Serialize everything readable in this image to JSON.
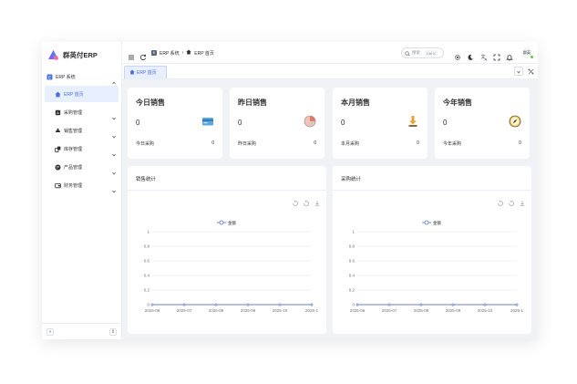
{
  "app": {
    "name": "群英付ERP"
  },
  "colors": {
    "accent": "#4a6fe0",
    "line": "#5470c6",
    "active_bg": "#e8efff"
  },
  "sidebar": {
    "group": {
      "label": "ERP 系统",
      "icon": "erp-icon"
    },
    "items": [
      {
        "label": "ERP 首页",
        "icon": "home-icon",
        "active": true
      },
      {
        "label": "采购管理",
        "icon": "purchase-icon"
      },
      {
        "label": "销售管理",
        "icon": "sales-icon"
      },
      {
        "label": "库存管理",
        "icon": "stock-icon"
      },
      {
        "label": "产品管理",
        "icon": "product-icon"
      },
      {
        "label": "财务管理",
        "icon": "finance-icon"
      }
    ],
    "collapse_label": "«",
    "lock_label": "⇕"
  },
  "header": {
    "breadcrumb": [
      "ERP 系统",
      "ERP 首页"
    ],
    "search_placeholder": "搜索",
    "shortcut": "Ctrl K",
    "avatar_label": "群英"
  },
  "tabs": [
    {
      "label": "ERP 首页"
    }
  ],
  "cards": [
    {
      "title": "今日销售",
      "value": "0",
      "foot_label": "今日采购",
      "foot_value": "0",
      "icon": "credit-card-icon"
    },
    {
      "title": "昨日销售",
      "value": "0",
      "foot_label": "昨日采购",
      "foot_value": "0",
      "icon": "pie-chart-icon"
    },
    {
      "title": "本月销售",
      "value": "0",
      "foot_label": "本月采购",
      "foot_value": "0",
      "icon": "download-icon"
    },
    {
      "title": "今年销售",
      "value": "0",
      "foot_label": "今年采购",
      "foot_value": "0",
      "icon": "compass-icon"
    }
  ],
  "chart_data": [
    {
      "type": "line",
      "title": "销售统计",
      "categories": [
        "2025-06",
        "2025-07",
        "2025-08",
        "2025-09",
        "2025-10",
        "2025-1"
      ],
      "series": [
        {
          "name": "金额",
          "values": [
            0,
            0,
            0,
            0,
            0,
            0
          ]
        }
      ],
      "yticks": [
        "0",
        "0.2",
        "0.4",
        "0.6",
        "0.8",
        "1"
      ],
      "ylim": [
        0,
        1
      ],
      "grid": true,
      "legend": "top-center"
    },
    {
      "type": "line",
      "title": "采购统计",
      "categories": [
        "2025-06",
        "2025-07",
        "2025-08",
        "2025-09",
        "2025-10",
        "2025-1"
      ],
      "series": [
        {
          "name": "金额",
          "values": [
            0,
            0,
            0,
            0,
            0,
            0
          ]
        }
      ],
      "yticks": [
        "0",
        "0.2",
        "0.4",
        "0.6",
        "0.8",
        "1"
      ],
      "ylim": [
        0,
        1
      ],
      "grid": true,
      "legend": "top-center"
    }
  ]
}
